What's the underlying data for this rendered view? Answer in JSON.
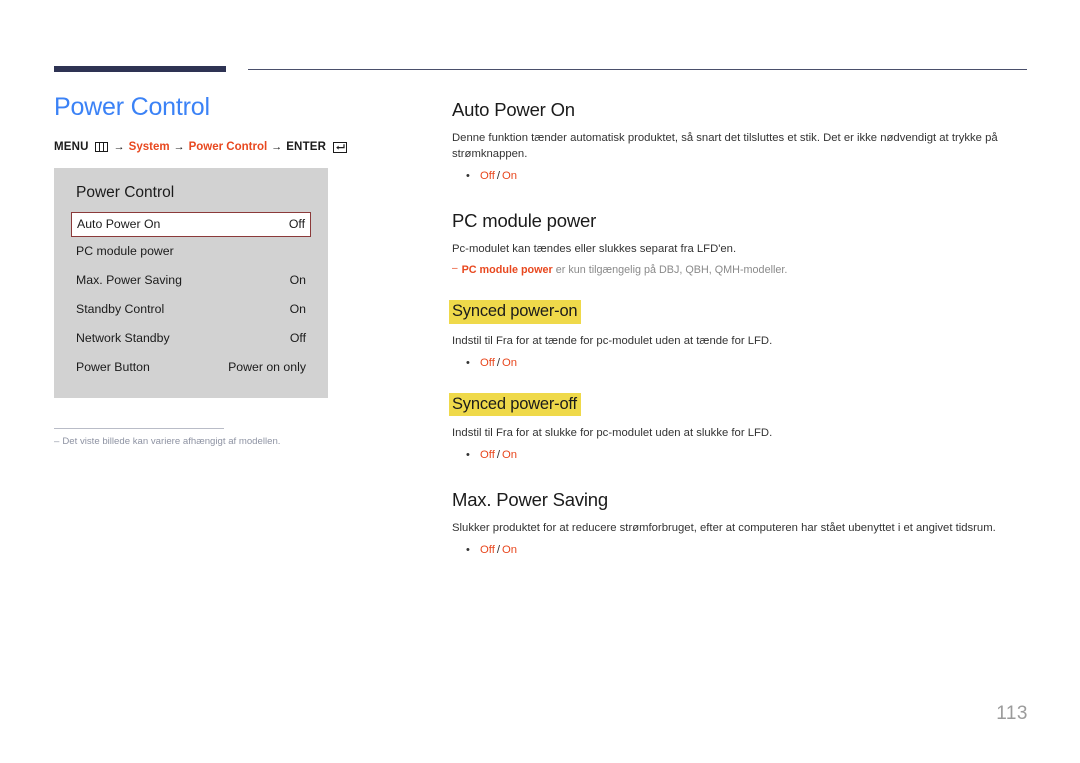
{
  "header": {
    "rule_color_thick": "#2e3353",
    "rule_color_thin": "#4a4f6b"
  },
  "left": {
    "page_title": "Power Control",
    "title_color": "#3b82f6",
    "breadcrumb": {
      "menu_label": "MENU",
      "menu_icon": "menu-grid-icon",
      "arrow1": "→",
      "path1": "System",
      "arrow2": "→",
      "path2": "Power Control",
      "arrow3": "→",
      "enter_label": "ENTER",
      "enter_icon": "enter-key-icon",
      "accent_color": "#e8481f"
    },
    "osd": {
      "title": "Power Control",
      "background": "#d2d2d2",
      "selected_border": "#8b3a3a",
      "rows": [
        {
          "label": "Auto Power On",
          "value": "Off",
          "selected": true
        },
        {
          "label": "PC module power",
          "value": "",
          "selected": false
        },
        {
          "label": "Max. Power Saving",
          "value": "On",
          "selected": false
        },
        {
          "label": "Standby Control",
          "value": "On",
          "selected": false
        },
        {
          "label": "Network Standby",
          "value": "Off",
          "selected": false
        },
        {
          "label": "Power Button",
          "value": "Power on only",
          "selected": false
        }
      ]
    },
    "note": {
      "dash": "‒",
      "text": "Det viste billede kan variere afhængigt af modellen."
    }
  },
  "right": {
    "sections": [
      {
        "heading": "Auto Power On",
        "body": "Denne funktion tænder automatisk produktet, så snart det tilsluttes et stik. Det er ikke nødvendigt at trykke på strømknappen.",
        "bullet": {
          "off": "Off",
          "sep": "/",
          "on": "On"
        }
      },
      {
        "heading": "PC module power",
        "body": "Pc-modulet kan tændes eller slukkes separat fra LFD'en.",
        "note": {
          "dash": "‒",
          "term": "PC module power",
          "rest": " er kun tilgængelig på DBJ, QBH, QMH-modeller."
        }
      },
      {
        "heading": "Synced power-on",
        "highlight": "#efd94a",
        "body": "Indstil til Fra for at tænde for pc-modulet uden at tænde for LFD.",
        "bullet": {
          "off": "Off",
          "sep": "/",
          "on": "On"
        }
      },
      {
        "heading": "Synced power-off",
        "highlight": "#efd94a",
        "body": "Indstil til Fra for at slukke for pc-modulet uden at slukke for LFD.",
        "bullet": {
          "off": "Off",
          "sep": "/",
          "on": "On"
        }
      },
      {
        "heading": "Max. Power Saving",
        "body": "Slukker produktet for at reducere strømforbruget, efter at computeren har stået ubenyttet i et angivet tidsrum.",
        "bullet": {
          "off": "Off",
          "sep": "/",
          "on": "On"
        }
      }
    ]
  },
  "footer": {
    "page_number": "113"
  }
}
